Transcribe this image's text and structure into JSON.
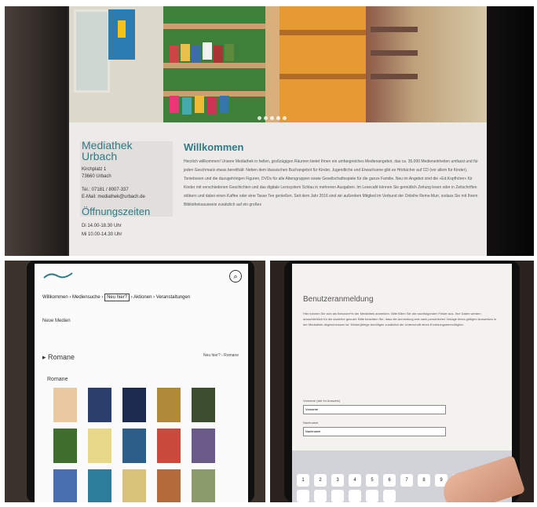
{
  "top": {
    "sidebar_title": "Mediathek Urbach",
    "address_street": "Kirchplatz 1",
    "address_city": "73660 Urbach",
    "phone": "Tel.: 07181 / 8007-337",
    "email": "E-Mail: mediathek@urbach.de",
    "hours_title": "Öffnungszeiten",
    "hours": [
      "Di 14.00-18.30 Uhr",
      "Mi 10.00-14.30 Uhr"
    ],
    "welcome_title": "Willkommen",
    "welcome_text": "Herzlich willkommen! Unsere Mediathek in hellen, großzügigen Räumen bietet Ihnen ein umfangreiches Medienangebot, das ca. 35.000 Medieneinheiten umfasst und für jeden Geschmack etwas bereithält: Neben dem klassischen Buchangebot für Kinder, Jugendliche und Erwachsene gibt es Hörbücher auf CD (vor allem für Kinder), Tonieboxen und die dazugehörigen Figuren, DVDs für alle Altersgruppen sowie Gesellschaftsspiele für die ganze Familie. Neu im Angebot sind die »Ed.Kopfhörer« für Kinder mit verschiedenen Geschichten und das digitale Lernsystem Schlau in mehreren Ausgaben. Im Lesecafé können Sie gemütlich Zeitung lesen oder in Zeitschriften stöbern und dabei einen Kaffee oder eine Tasse Tee genießen. Seit dem Jahr 2016 sind wir außerdem Mitglied im Verbund der Onleihe Rems-Murr, sodass Sie mit Ihrem Bibliotheksausweis zusätzlich auf ein großes"
  },
  "bottom_left": {
    "nav": [
      "Willkommen",
      "Mediensuche",
      "Neu hier?",
      "Aktionen",
      "Veranstaltungen"
    ],
    "nav_active": "Neu hier?",
    "sub_item": "Neue Medien",
    "section": "Romane",
    "back_label": "Neu hier? › Romane",
    "grid_title": "Romane",
    "cover_colors": [
      "#e9c9a0",
      "#2a3f6b",
      "#1b2b4f",
      "#b08a3a",
      "#3c4e2f",
      "#3e6d2e",
      "#e8d98a",
      "#2b5f8a",
      "#c94a3a",
      "#6a5a8a",
      "#4a6fb0",
      "#2c7d9a",
      "#d8c27a",
      "#b46a3a",
      "#8a9a6a"
    ]
  },
  "bottom_right": {
    "form_title": "Benutzeranmeldung",
    "form_text": "Hier können Sie sich als Benutzer*in der Mediathek anmelden. Bitte füllen Sie die nachfolgenden Felder aus. Ihre Daten werden ausschließlich für die Ausleihe genutzt. Bitte beachten Sie, dass die Anmeldung erst nach persönlicher Vorlage eines gültigen Ausweises in der Mediathek abgeschlossen ist. Minderjährige benötigen zusätzlich die Unterschrift eines Erziehungsberechtigten.",
    "field1_label": "Vorname (wie im Ausweis)",
    "field1_value": "Vorname",
    "field2_label": "Nachname",
    "field2_value": "Nachname",
    "keys": [
      "1",
      "2",
      "3",
      "4",
      "5",
      "6",
      "7",
      "8",
      "9",
      "0"
    ]
  }
}
